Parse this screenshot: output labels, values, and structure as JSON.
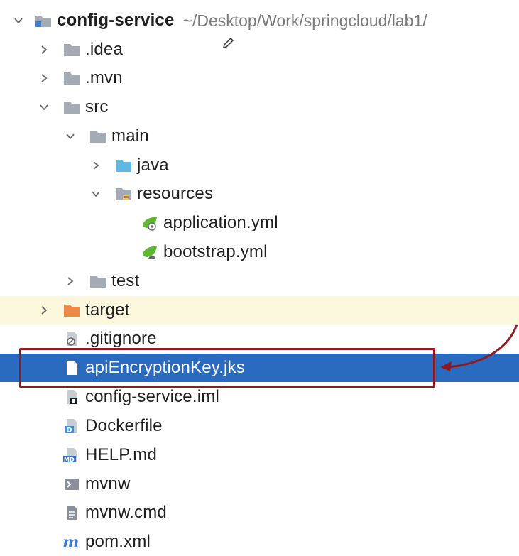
{
  "root": {
    "name": "config-service",
    "path": "~/Desktop/Work/springcloud/lab1/"
  },
  "items": [
    {
      "label": ".idea",
      "icon": "folder-icon"
    },
    {
      "label": ".mvn",
      "icon": "folder-icon"
    },
    {
      "label": "src",
      "icon": "folder-icon"
    },
    {
      "label": "main",
      "icon": "folder-icon"
    },
    {
      "label": "java",
      "icon": "source-folder-icon"
    },
    {
      "label": "resources",
      "icon": "resources-folder-icon"
    },
    {
      "label": "application.yml",
      "icon": "spring-config-icon"
    },
    {
      "label": "bootstrap.yml",
      "icon": "spring-config-icon"
    },
    {
      "label": "test",
      "icon": "folder-icon"
    },
    {
      "label": "target",
      "icon": "excluded-folder-icon"
    },
    {
      "label": ".gitignore",
      "icon": "ignore-file-icon"
    },
    {
      "label": "apiEncryptionKey.jks",
      "icon": "file-icon"
    },
    {
      "label": "config-service.iml",
      "icon": "module-file-icon"
    },
    {
      "label": "Dockerfile",
      "icon": "docker-file-icon"
    },
    {
      "label": "HELP.md",
      "icon": "markdown-file-icon"
    },
    {
      "label": "mvnw",
      "icon": "shell-script-icon"
    },
    {
      "label": "mvnw.cmd",
      "icon": "cmd-file-icon"
    },
    {
      "label": "pom.xml",
      "icon": "maven-icon"
    }
  ],
  "colors": {
    "selection": "#2b6bbf",
    "highlight_row": "#fbf8dd",
    "callout": "#8e1b22",
    "folder": "#a4abb5",
    "source_folder": "#62b6e4",
    "excluded_folder": "#ec8a4c",
    "spring": "#5fb832"
  }
}
